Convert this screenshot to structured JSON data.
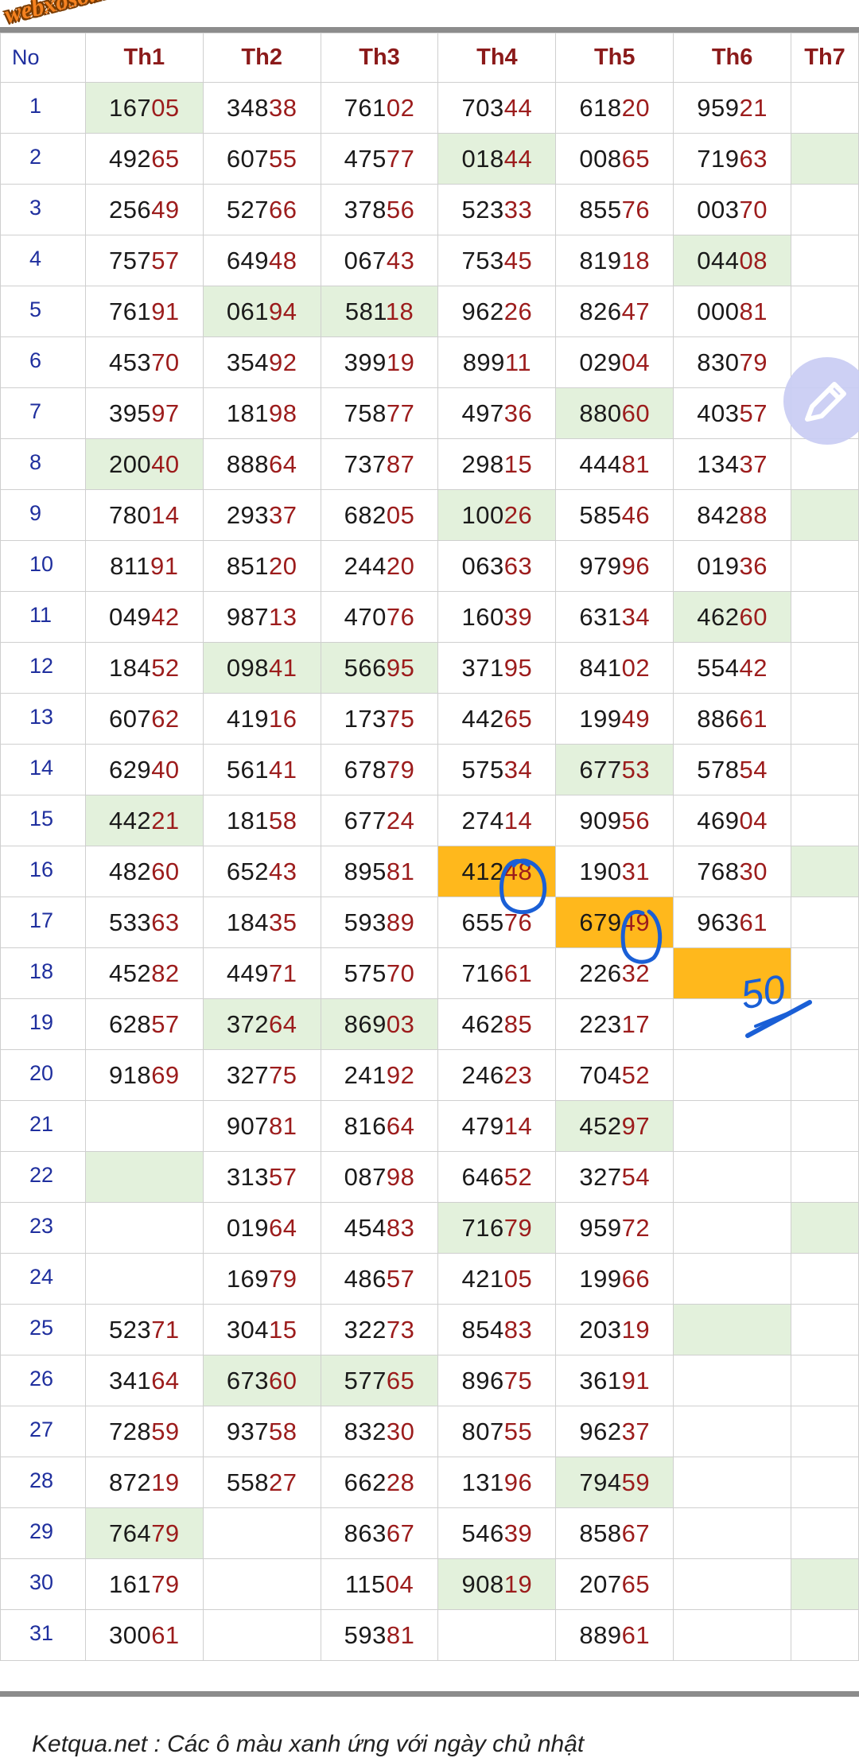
{
  "watermark": "webxoso.net",
  "headers": [
    "No",
    "Th1",
    "Th2",
    "Th3",
    "Th4",
    "Th5",
    "Th6",
    "Th7"
  ],
  "rows": [
    {
      "day": "1",
      "cells": [
        {
          "v": "16705",
          "bg": "green"
        },
        {
          "v": "34838"
        },
        {
          "v": "76102"
        },
        {
          "v": "70344"
        },
        {
          "v": "61820"
        },
        {
          "v": "95921"
        },
        {
          "v": ""
        }
      ]
    },
    {
      "day": "2",
      "cells": [
        {
          "v": "49265"
        },
        {
          "v": "60755"
        },
        {
          "v": "47577"
        },
        {
          "v": "01844",
          "bg": "green"
        },
        {
          "v": "00865"
        },
        {
          "v": "71963"
        },
        {
          "v": "",
          "bg": "green"
        }
      ]
    },
    {
      "day": "3",
      "cells": [
        {
          "v": "25649"
        },
        {
          "v": "52766"
        },
        {
          "v": "37856"
        },
        {
          "v": "52333"
        },
        {
          "v": "85576"
        },
        {
          "v": "00370"
        },
        {
          "v": ""
        }
      ]
    },
    {
      "day": "4",
      "cells": [
        {
          "v": "75757"
        },
        {
          "v": "64948"
        },
        {
          "v": "06743"
        },
        {
          "v": "75345"
        },
        {
          "v": "81918"
        },
        {
          "v": "04408",
          "bg": "green"
        },
        {
          "v": ""
        }
      ]
    },
    {
      "day": "5",
      "cells": [
        {
          "v": "76191"
        },
        {
          "v": "06194",
          "bg": "green"
        },
        {
          "v": "58118",
          "bg": "green"
        },
        {
          "v": "96226"
        },
        {
          "v": "82647"
        },
        {
          "v": "00081"
        },
        {
          "v": ""
        }
      ]
    },
    {
      "day": "6",
      "cells": [
        {
          "v": "45370"
        },
        {
          "v": "35492"
        },
        {
          "v": "39919"
        },
        {
          "v": "89911"
        },
        {
          "v": "02904"
        },
        {
          "v": "83079"
        },
        {
          "v": ""
        }
      ]
    },
    {
      "day": "7",
      "cells": [
        {
          "v": "39597"
        },
        {
          "v": "18198"
        },
        {
          "v": "75877"
        },
        {
          "v": "49736"
        },
        {
          "v": "88060",
          "bg": "green"
        },
        {
          "v": "40357"
        },
        {
          "v": ""
        }
      ]
    },
    {
      "day": "8",
      "cells": [
        {
          "v": "20040",
          "bg": "green"
        },
        {
          "v": "88864"
        },
        {
          "v": "73787"
        },
        {
          "v": "29815"
        },
        {
          "v": "44481"
        },
        {
          "v": "13437"
        },
        {
          "v": ""
        }
      ]
    },
    {
      "day": "9",
      "cells": [
        {
          "v": "78014"
        },
        {
          "v": "29337"
        },
        {
          "v": "68205"
        },
        {
          "v": "10026",
          "bg": "green"
        },
        {
          "v": "58546"
        },
        {
          "v": "84288"
        },
        {
          "v": "",
          "bg": "green"
        }
      ]
    },
    {
      "day": "10",
      "cells": [
        {
          "v": "81191"
        },
        {
          "v": "85120"
        },
        {
          "v": "24420"
        },
        {
          "v": "06363"
        },
        {
          "v": "97996"
        },
        {
          "v": "01936"
        },
        {
          "v": ""
        }
      ]
    },
    {
      "day": "11",
      "cells": [
        {
          "v": "04942"
        },
        {
          "v": "98713"
        },
        {
          "v": "47076"
        },
        {
          "v": "16039"
        },
        {
          "v": "63134"
        },
        {
          "v": "46260",
          "bg": "green"
        },
        {
          "v": ""
        }
      ]
    },
    {
      "day": "12",
      "cells": [
        {
          "v": "18452"
        },
        {
          "v": "09841",
          "bg": "green"
        },
        {
          "v": "56695",
          "bg": "green"
        },
        {
          "v": "37195"
        },
        {
          "v": "84102"
        },
        {
          "v": "55442"
        },
        {
          "v": ""
        }
      ]
    },
    {
      "day": "13",
      "cells": [
        {
          "v": "60762"
        },
        {
          "v": "41916"
        },
        {
          "v": "17375"
        },
        {
          "v": "44265"
        },
        {
          "v": "19949"
        },
        {
          "v": "88661"
        },
        {
          "v": ""
        }
      ]
    },
    {
      "day": "14",
      "cells": [
        {
          "v": "62940"
        },
        {
          "v": "56141"
        },
        {
          "v": "67879"
        },
        {
          "v": "57534"
        },
        {
          "v": "67753",
          "bg": "green"
        },
        {
          "v": "57854"
        },
        {
          "v": ""
        }
      ]
    },
    {
      "day": "15",
      "cells": [
        {
          "v": "44221",
          "bg": "green"
        },
        {
          "v": "18158"
        },
        {
          "v": "67724"
        },
        {
          "v": "27414"
        },
        {
          "v": "90956"
        },
        {
          "v": "46904"
        },
        {
          "v": ""
        }
      ]
    },
    {
      "day": "16",
      "cells": [
        {
          "v": "48260"
        },
        {
          "v": "65243"
        },
        {
          "v": "89581"
        },
        {
          "v": "41248",
          "bg": "orange"
        },
        {
          "v": "19031"
        },
        {
          "v": "76830"
        },
        {
          "v": "",
          "bg": "green"
        }
      ]
    },
    {
      "day": "17",
      "cells": [
        {
          "v": "53363"
        },
        {
          "v": "18435"
        },
        {
          "v": "59389"
        },
        {
          "v": "65576"
        },
        {
          "v": "67949",
          "bg": "orange"
        },
        {
          "v": "96361"
        },
        {
          "v": ""
        }
      ]
    },
    {
      "day": "18",
      "cells": [
        {
          "v": "45282"
        },
        {
          "v": "44971"
        },
        {
          "v": "57570"
        },
        {
          "v": "71661"
        },
        {
          "v": "22632"
        },
        {
          "v": "",
          "bg": "orange"
        },
        {
          "v": ""
        }
      ]
    },
    {
      "day": "19",
      "cells": [
        {
          "v": "62857"
        },
        {
          "v": "37264",
          "bg": "green"
        },
        {
          "v": "86903",
          "bg": "green"
        },
        {
          "v": "46285"
        },
        {
          "v": "22317"
        },
        {
          "v": ""
        },
        {
          "v": ""
        }
      ]
    },
    {
      "day": "20",
      "cells": [
        {
          "v": "91869"
        },
        {
          "v": "32775"
        },
        {
          "v": "24192"
        },
        {
          "v": "24623"
        },
        {
          "v": "70452"
        },
        {
          "v": ""
        },
        {
          "v": ""
        }
      ]
    },
    {
      "day": "21",
      "cells": [
        {
          "v": ""
        },
        {
          "v": "90781"
        },
        {
          "v": "81664"
        },
        {
          "v": "47914"
        },
        {
          "v": "45297",
          "bg": "green"
        },
        {
          "v": ""
        },
        {
          "v": ""
        }
      ]
    },
    {
      "day": "22",
      "cells": [
        {
          "v": "",
          "bg": "green"
        },
        {
          "v": "31357"
        },
        {
          "v": "08798"
        },
        {
          "v": "64652"
        },
        {
          "v": "32754"
        },
        {
          "v": ""
        },
        {
          "v": ""
        }
      ]
    },
    {
      "day": "23",
      "cells": [
        {
          "v": ""
        },
        {
          "v": "01964"
        },
        {
          "v": "45483"
        },
        {
          "v": "71679",
          "bg": "green"
        },
        {
          "v": "95972"
        },
        {
          "v": ""
        },
        {
          "v": "",
          "bg": "green"
        }
      ]
    },
    {
      "day": "24",
      "cells": [
        {
          "v": ""
        },
        {
          "v": "16979"
        },
        {
          "v": "48657"
        },
        {
          "v": "42105"
        },
        {
          "v": "19966"
        },
        {
          "v": ""
        },
        {
          "v": ""
        }
      ]
    },
    {
      "day": "25",
      "cells": [
        {
          "v": "52371"
        },
        {
          "v": "30415"
        },
        {
          "v": "32273"
        },
        {
          "v": "85483"
        },
        {
          "v": "20319"
        },
        {
          "v": "",
          "bg": "green"
        },
        {
          "v": ""
        }
      ]
    },
    {
      "day": "26",
      "cells": [
        {
          "v": "34164"
        },
        {
          "v": "67360",
          "bg": "green"
        },
        {
          "v": "57765",
          "bg": "green"
        },
        {
          "v": "89675"
        },
        {
          "v": "36191"
        },
        {
          "v": ""
        },
        {
          "v": ""
        }
      ]
    },
    {
      "day": "27",
      "cells": [
        {
          "v": "72859"
        },
        {
          "v": "93758"
        },
        {
          "v": "83230"
        },
        {
          "v": "80755"
        },
        {
          "v": "96237"
        },
        {
          "v": ""
        },
        {
          "v": ""
        }
      ]
    },
    {
      "day": "28",
      "cells": [
        {
          "v": "87219"
        },
        {
          "v": "55827"
        },
        {
          "v": "66228"
        },
        {
          "v": "13196"
        },
        {
          "v": "79459",
          "bg": "green"
        },
        {
          "v": ""
        },
        {
          "v": ""
        }
      ]
    },
    {
      "day": "29",
      "cells": [
        {
          "v": "76479",
          "bg": "green"
        },
        {
          "v": ""
        },
        {
          "v": "86367"
        },
        {
          "v": "54639"
        },
        {
          "v": "85867"
        },
        {
          "v": ""
        },
        {
          "v": ""
        }
      ]
    },
    {
      "day": "30",
      "cells": [
        {
          "v": "16179"
        },
        {
          "v": ""
        },
        {
          "v": "11504"
        },
        {
          "v": "90819",
          "bg": "green"
        },
        {
          "v": "20765"
        },
        {
          "v": ""
        },
        {
          "v": "",
          "bg": "green"
        }
      ]
    },
    {
      "day": "31",
      "cells": [
        {
          "v": "30061"
        },
        {
          "v": ""
        },
        {
          "v": "59381"
        },
        {
          "v": ""
        },
        {
          "v": "88961"
        },
        {
          "v": ""
        },
        {
          "v": ""
        }
      ]
    }
  ],
  "annotation": {
    "handwritten_number": "50",
    "ink_color": "#1a5fd6"
  },
  "footer_text": "Ketqua.net : Các ô màu xanh ứng với ngày chủ nhật",
  "colors": {
    "green_cell": "#e3f1dc",
    "orange_cell": "#ffb81c",
    "header_text": "#8b1a1a",
    "day_text": "#1f2f9e",
    "tail_digits": "#9c1c1c"
  }
}
